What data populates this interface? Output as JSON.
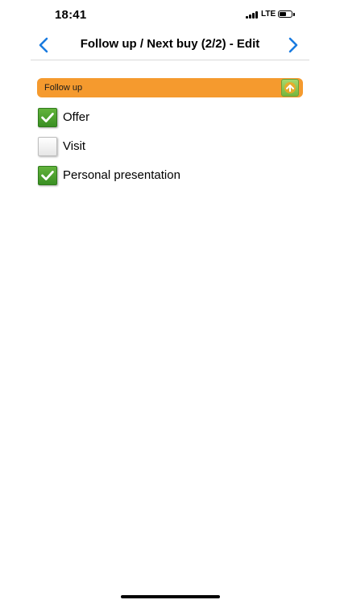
{
  "status_bar": {
    "time": "18:41",
    "network": "LTE",
    "signal_icon": "signal-bars-icon",
    "battery_icon": "battery-icon",
    "battery_level": 0.6
  },
  "nav": {
    "title": "Follow up / Next buy (2/2) - Edit",
    "back_icon": "chevron-left-icon",
    "forward_icon": "chevron-right-icon",
    "accent_color": "#1a7be0"
  },
  "section": {
    "title": "Follow up",
    "color": "#f59a2e",
    "collapse_icon": "arrow-up-icon"
  },
  "items": [
    {
      "label": "Offer",
      "checked": true
    },
    {
      "label": "Visit",
      "checked": false
    },
    {
      "label": "Personal presentation",
      "checked": true
    }
  ]
}
